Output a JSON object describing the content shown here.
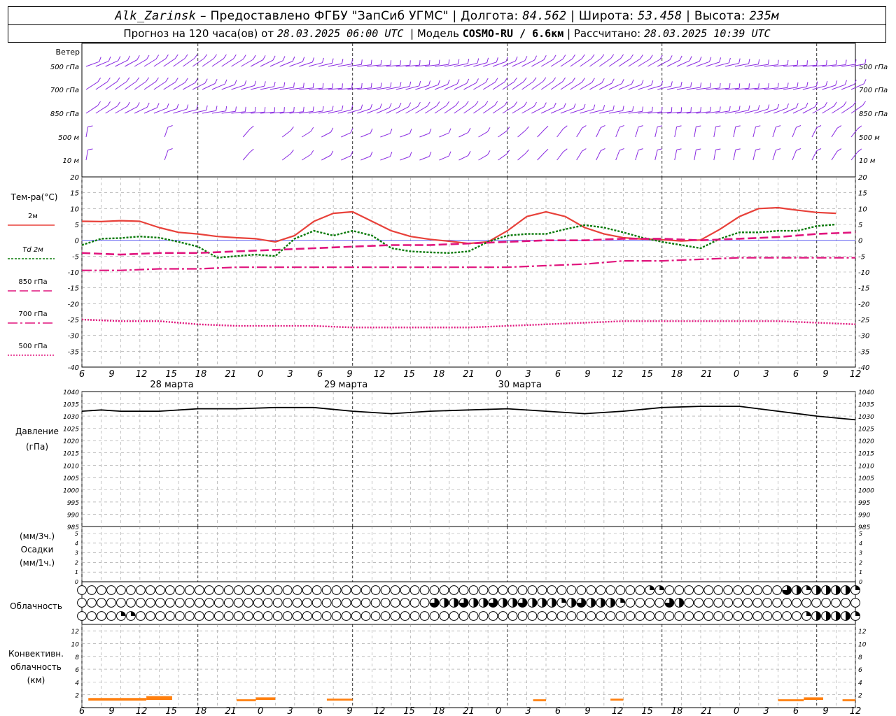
{
  "header": {
    "station": "Alk_Zarinsk",
    "provider": "– Предоставлено ФГБУ \"ЗапСиб УГМС\"",
    "lon_label": "Долгота:",
    "lon": "84.562",
    "lat_label": "Широта:",
    "lat": "53.458",
    "alt_label": "Высота:",
    "alt": "235м",
    "forecast_label": "Прогноз на 120 часа(ов) от",
    "forecast_start": "28.03.2025 06:00 UTC",
    "model_label": "Модель",
    "model": "COSMO-RU / 6.6км",
    "calc_label": "Рассчитано:",
    "calc_time": "28.03.2025 10:39 UTC"
  },
  "wind_panel": {
    "title": "Ветер",
    "levels": [
      "500 гПа",
      "700 гПа",
      "850 гПа",
      "500 м",
      "10  м"
    ]
  },
  "temp_panel": {
    "title": "Тем-ра(°C)",
    "legend": [
      "2м",
      "Td 2м",
      "850 гПа",
      "700 гПа",
      "500 гПа"
    ]
  },
  "pressure_panel": {
    "title": "Давление",
    "unit": "(гПа)"
  },
  "precip_panel": {
    "unit_top": "(мм/3ч.)",
    "title": "Осадки",
    "unit_bottom": "(мм/1ч.)"
  },
  "cloud_panel": {
    "title": "Облачность"
  },
  "conv_panel": {
    "title": "Конвективн.",
    "title2": "облачность",
    "unit": "(км)"
  },
  "x_axis": {
    "hour_labels": [
      "6",
      "9",
      "12",
      "15",
      "18",
      "21",
      "0",
      "3",
      "6",
      "9",
      "12",
      "15",
      "18",
      "21",
      "0",
      "3",
      "6",
      "9",
      "12",
      "15",
      "18",
      "21",
      "0",
      "3",
      "6",
      "9",
      "12"
    ],
    "date_labels": [
      "28 марта",
      "29 марта",
      "30 марта"
    ]
  },
  "colors": {
    "wind": "#8a2be2",
    "t2m": "#e8413a",
    "td2m": "#0a7a0a",
    "t850": "#e0147d",
    "pressure": "#000000",
    "conv": "#ff7f0e",
    "grid": "#999999"
  },
  "chart_data": [
    {
      "type": "line",
      "title": "Тем-ра(°C)",
      "ylim": [
        -40,
        20
      ],
      "x_unit": "hours since 28.03.2025 06:00 UTC",
      "series": [
        {
          "name": "2м",
          "x": [
            0,
            3,
            6,
            9,
            12,
            15,
            18,
            21,
            24,
            27,
            30,
            33,
            36,
            39,
            42,
            45,
            48,
            51,
            54,
            57,
            60,
            63,
            66,
            69,
            72,
            75,
            78,
            81,
            84,
            87,
            90,
            93,
            96,
            99,
            102,
            105,
            108,
            111,
            114,
            117
          ],
          "values": [
            6,
            5.9,
            6.2,
            6,
            4,
            2.5,
            2,
            1.2,
            0.8,
            0.5,
            -0.5,
            1.5,
            6,
            8.5,
            9,
            6,
            3,
            1.2,
            0.3,
            -0.3,
            -1,
            -0.5,
            3,
            7.5,
            9,
            7.5,
            4,
            2,
            0.8,
            0.4,
            0.2,
            -0.2,
            0.1,
            3.5,
            7.5,
            10,
            10.3,
            9.5,
            8.8,
            8.5
          ]
        },
        {
          "name": "Td 2м",
          "x": [
            0,
            3,
            6,
            9,
            12,
            15,
            18,
            21,
            24,
            27,
            30,
            33,
            36,
            39,
            42,
            45,
            48,
            51,
            54,
            57,
            60,
            63,
            66,
            69,
            72,
            75,
            78,
            81,
            84,
            87,
            90,
            93,
            96,
            99,
            102,
            105,
            108,
            111,
            114,
            117
          ],
          "values": [
            -1.5,
            0.5,
            0.7,
            1.2,
            0.8,
            -0.5,
            -2,
            -5.5,
            -5,
            -4.5,
            -5,
            0.5,
            3,
            1.5,
            3,
            1.5,
            -2.5,
            -3.5,
            -3.8,
            -4,
            -3.5,
            -0.5,
            1.5,
            2,
            2,
            3.5,
            4.8,
            4,
            2.5,
            0.8,
            -0.5,
            -1.5,
            -2.5,
            0.5,
            2.5,
            2.5,
            3,
            3,
            4.5,
            5
          ]
        },
        {
          "name": "850 гПа",
          "x": [
            0,
            6,
            12,
            18,
            24,
            30,
            36,
            42,
            48,
            54,
            60,
            66,
            72,
            78,
            84,
            90,
            96,
            102,
            108,
            114,
            120
          ],
          "values": [
            -4,
            -4.5,
            -4,
            -4,
            -3.5,
            -3,
            -2.5,
            -2,
            -1.5,
            -1.5,
            -1,
            -0.5,
            0,
            0,
            0.5,
            0.5,
            0,
            0.5,
            1,
            2,
            2.5
          ]
        },
        {
          "name": "700 гПа",
          "x": [
            0,
            6,
            12,
            18,
            24,
            30,
            36,
            42,
            48,
            54,
            60,
            66,
            72,
            78,
            84,
            90,
            96,
            102,
            108,
            114,
            120
          ],
          "values": [
            -9.5,
            -9.5,
            -9,
            -9,
            -8.5,
            -8.5,
            -8.5,
            -8.5,
            -8.5,
            -8.5,
            -8.5,
            -8.5,
            -8,
            -7.5,
            -6.5,
            -6.5,
            -6,
            -5.5,
            -5.5,
            -5.5,
            -5.5
          ]
        },
        {
          "name": "500 гПа",
          "x": [
            0,
            6,
            12,
            18,
            24,
            30,
            36,
            42,
            48,
            54,
            60,
            66,
            72,
            78,
            84,
            90,
            96,
            102,
            108,
            114,
            120
          ],
          "values": [
            -25,
            -25.5,
            -25.5,
            -26.5,
            -27,
            -27,
            -27,
            -27.5,
            -27.5,
            -27.5,
            -27.5,
            -27,
            -26.5,
            -26,
            -25.5,
            -25.5,
            -25.5,
            -25.5,
            -25.5,
            -26,
            -26.5
          ]
        }
      ]
    },
    {
      "type": "line",
      "title": "Давление",
      "ylabel": "(гПа)",
      "ylim": [
        985,
        1040
      ],
      "x_unit": "hours since 28.03.2025 06:00 UTC",
      "series": [
        {
          "name": "Давление",
          "x": [
            0,
            3,
            6,
            12,
            18,
            24,
            30,
            36,
            42,
            48,
            54,
            60,
            66,
            72,
            78,
            84,
            90,
            96,
            102,
            108,
            114,
            120
          ],
          "values": [
            1032,
            1032.5,
            1032,
            1032,
            1033,
            1033,
            1033.5,
            1033.5,
            1032,
            1031,
            1032,
            1032.5,
            1033,
            1032,
            1031,
            1032,
            1033.5,
            1034,
            1034,
            1032,
            1030,
            1028.5
          ]
        }
      ]
    },
    {
      "type": "bar",
      "title": "Конвективн. облачность",
      "ylabel": "(км)",
      "ylim": [
        0,
        13
      ],
      "x_unit": "hours since 28.03.2025 06:00 UTC",
      "segments": [
        {
          "x0": 1,
          "x1": 10,
          "base": 1.1,
          "top": 1.5
        },
        {
          "x0": 10,
          "x1": 14,
          "base": 1.2,
          "top": 1.8
        },
        {
          "x0": 24,
          "x1": 27,
          "base": 1.0,
          "top": 1.3
        },
        {
          "x0": 27,
          "x1": 30,
          "base": 1.2,
          "top": 1.6
        },
        {
          "x0": 38,
          "x1": 42,
          "base": 1.1,
          "top": 1.4
        },
        {
          "x0": 70,
          "x1": 72,
          "base": 1.0,
          "top": 1.3
        },
        {
          "x0": 82,
          "x1": 84,
          "base": 1.1,
          "top": 1.4
        },
        {
          "x0": 108,
          "x1": 112,
          "base": 1.0,
          "top": 1.3
        },
        {
          "x0": 112,
          "x1": 115,
          "base": 1.2,
          "top": 1.6
        },
        {
          "x0": 118,
          "x1": 120,
          "base": 1.0,
          "top": 1.3
        }
      ]
    }
  ]
}
